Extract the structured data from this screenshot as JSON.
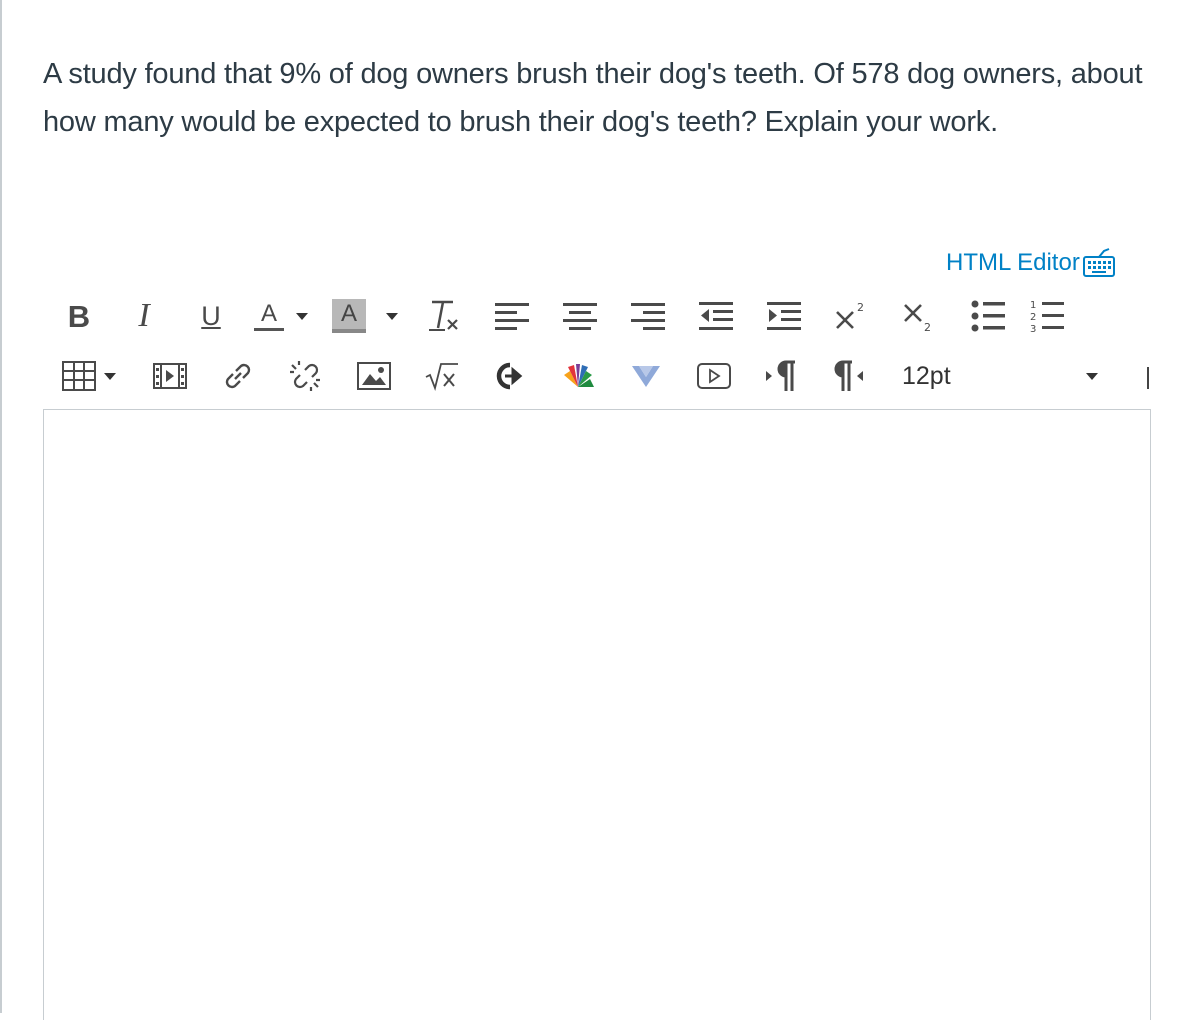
{
  "question": {
    "text": "A study found that 9% of dog owners brush their dog's teeth.  Of 578 dog owners, about how many would be expected to brush their dog's teeth?  Explain your work."
  },
  "editor": {
    "html_editor_label": "HTML Editor",
    "font_size": "12pt",
    "body_text": ""
  },
  "toolbar": {
    "row1": [
      "bold-icon",
      "italic-icon",
      "underline-icon",
      "text-color-icon",
      "background-color-icon",
      "clear-formatting-icon",
      "align-left-icon",
      "align-center-icon",
      "align-right-icon",
      "outdent-icon",
      "indent-icon",
      "superscript-icon",
      "subscript-icon",
      "bullet-list-icon",
      "numbered-list-icon"
    ],
    "row2": [
      "table-icon",
      "media-icon",
      "link-icon",
      "unlink-icon",
      "image-icon",
      "equation-icon",
      "lti-tool-icon",
      "nbc-learn-icon",
      "vimeo-icon",
      "youtube-embed-icon",
      "ltr-icon",
      "rtl-icon"
    ],
    "letters": {
      "bold": "B",
      "italic": "I",
      "underline": "U",
      "text_color": "A",
      "background_color": "A"
    },
    "link_color": "#0081c6",
    "icon_color": "#4a4a4a"
  }
}
